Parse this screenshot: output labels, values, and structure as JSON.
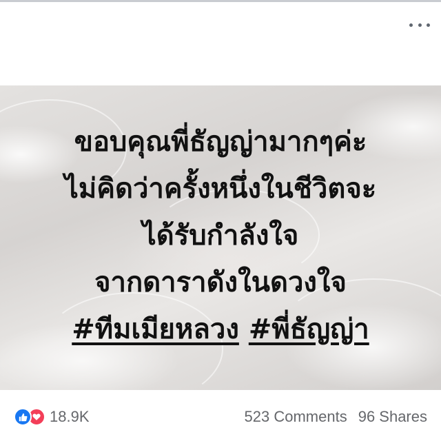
{
  "post": {
    "text_lines": [
      "ขอบคุณพี่ธัญญ่ามากๆค่ะ",
      "ไม่คิดว่าครั้งหนึ่งในชีวิตจะ",
      "ได้รับกำลังใจ",
      "จากดาราดังในดวงใจ"
    ],
    "hashtags": [
      "#ทีมเมียหลวง",
      "#พี่ธัญญ่า"
    ]
  },
  "footer": {
    "reaction_count": "18.9K",
    "comments": "523 Comments",
    "shares": "96 Shares"
  },
  "icons": {
    "more": "more-options-icon",
    "like": "like-reaction-icon",
    "love": "love-reaction-icon"
  },
  "colors": {
    "like": "#1877f2",
    "love": "#f33e58",
    "meta_text": "#65676b"
  }
}
